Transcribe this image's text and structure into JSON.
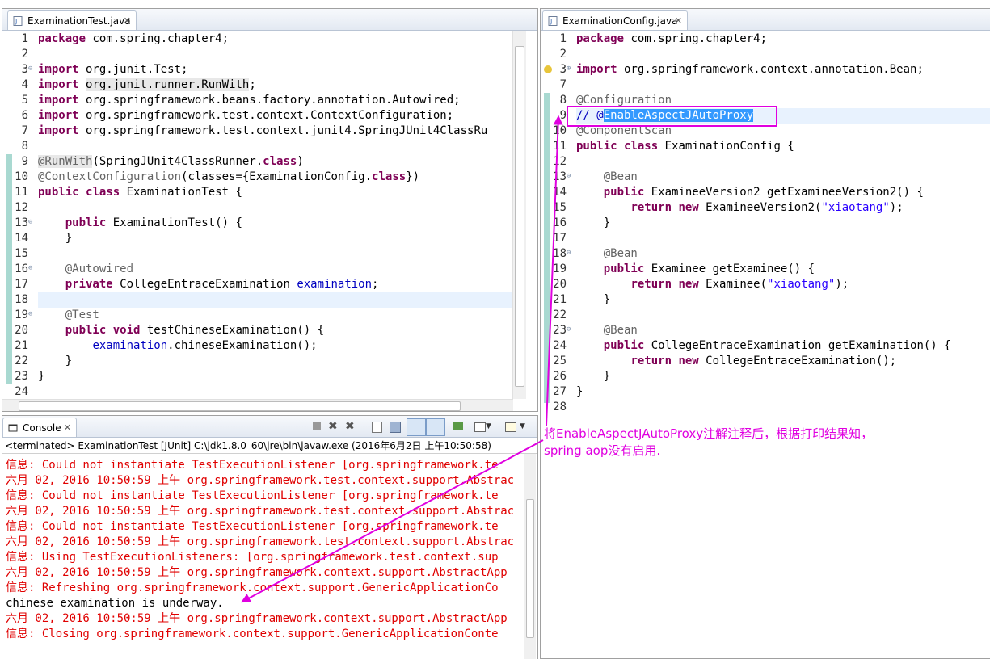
{
  "left_editor": {
    "tab_title": "ExaminationTest.java",
    "lines": [
      {
        "n": "1",
        "t": "package com.spring.chapter4;"
      },
      {
        "n": "2",
        "t": ""
      },
      {
        "n": "3",
        "t": "import org.junit.Test;"
      },
      {
        "n": "4",
        "t": "import org.junit.runner.RunWith;"
      },
      {
        "n": "5",
        "t": "import org.springframework.beans.factory.annotation.Autowired;"
      },
      {
        "n": "6",
        "t": "import org.springframework.test.context.ContextConfiguration;"
      },
      {
        "n": "7",
        "t": "import org.springframework.test.context.junit4.SpringJUnit4ClassRu"
      },
      {
        "n": "8",
        "t": ""
      },
      {
        "n": "9",
        "t": "@RunWith(SpringJUnit4ClassRunner.class)"
      },
      {
        "n": "10",
        "t": "@ContextConfiguration(classes={ExaminationConfig.class})"
      },
      {
        "n": "11",
        "t": "public class ExaminationTest {"
      },
      {
        "n": "12",
        "t": ""
      },
      {
        "n": "13",
        "t": "    public ExaminationTest() {"
      },
      {
        "n": "14",
        "t": "    }"
      },
      {
        "n": "15",
        "t": ""
      },
      {
        "n": "16",
        "t": "    @Autowired"
      },
      {
        "n": "17",
        "t": "    private CollegeEntraceExamination examination;"
      },
      {
        "n": "18",
        "t": ""
      },
      {
        "n": "19",
        "t": "    @Test"
      },
      {
        "n": "20",
        "t": "    public void testChineseExamination() {"
      },
      {
        "n": "21",
        "t": "        examination.chineseExamination();"
      },
      {
        "n": "22",
        "t": "    }"
      },
      {
        "n": "23",
        "t": "}"
      },
      {
        "n": "24",
        "t": ""
      }
    ]
  },
  "right_editor": {
    "tab_title": "ExaminationConfig.java",
    "lines": [
      {
        "n": "1",
        "t": "package com.spring.chapter4;"
      },
      {
        "n": "2",
        "t": ""
      },
      {
        "n": "3",
        "t": "import org.springframework.context.annotation.Bean;"
      },
      {
        "n": "7",
        "t": ""
      },
      {
        "n": "8",
        "t": "@Configuration"
      },
      {
        "n": "9",
        "t": "// @EnableAspectJAutoProxy"
      },
      {
        "n": "10",
        "t": "@ComponentScan"
      },
      {
        "n": "11",
        "t": "public class ExaminationConfig {"
      },
      {
        "n": "12",
        "t": ""
      },
      {
        "n": "13",
        "t": "    @Bean"
      },
      {
        "n": "14",
        "t": "    public ExamineeVersion2 getExamineeVersion2() {"
      },
      {
        "n": "15",
        "t": "        return new ExamineeVersion2(\"xiaotang\");"
      },
      {
        "n": "16",
        "t": "    }"
      },
      {
        "n": "17",
        "t": ""
      },
      {
        "n": "18",
        "t": "    @Bean"
      },
      {
        "n": "19",
        "t": "    public Examinee getExaminee() {"
      },
      {
        "n": "20",
        "t": "        return new Examinee(\"xiaotang\");"
      },
      {
        "n": "21",
        "t": "    }"
      },
      {
        "n": "22",
        "t": ""
      },
      {
        "n": "23",
        "t": "    @Bean"
      },
      {
        "n": "24",
        "t": "    public CollegeEntraceExamination getExamination() {"
      },
      {
        "n": "25",
        "t": "        return new CollegeEntraceExamination();"
      },
      {
        "n": "26",
        "t": "    }"
      },
      {
        "n": "27",
        "t": "}"
      },
      {
        "n": "28",
        "t": ""
      }
    ]
  },
  "console": {
    "tab_title": "Console",
    "status": "<terminated> ExaminationTest [JUnit] C:\\jdk1.8.0_60\\jre\\bin\\javaw.exe (2016年6月2日 上午10:50:58)",
    "lines": [
      {
        "t": "信息: Could not instantiate TestExecutionListener [org.springframework.te",
        "c": "red"
      },
      {
        "t": "六月 02, 2016 10:50:59 上午 org.springframework.test.context.support.Abstrac",
        "c": "red"
      },
      {
        "t": "信息: Could not instantiate TestExecutionListener [org.springframework.te",
        "c": "red"
      },
      {
        "t": "六月 02, 2016 10:50:59 上午 org.springframework.test.context.support.Abstrac",
        "c": "red"
      },
      {
        "t": "信息: Could not instantiate TestExecutionListener [org.springframework.te",
        "c": "red"
      },
      {
        "t": "六月 02, 2016 10:50:59 上午 org.springframework.test.context.support.Abstrac",
        "c": "red"
      },
      {
        "t": "信息: Using TestExecutionListeners: [org.springframework.test.context.sup",
        "c": "red"
      },
      {
        "t": "六月 02, 2016 10:50:59 上午 org.springframework.context.support.AbstractApp",
        "c": "red"
      },
      {
        "t": "信息: Refreshing org.springframework.context.support.GenericApplicationCo",
        "c": "red"
      },
      {
        "t": "chinese examination is underway.",
        "c": "black"
      },
      {
        "t": "六月 02, 2016 10:50:59 上午 org.springframework.context.support.AbstractApp",
        "c": "red"
      },
      {
        "t": "信息: Closing org.springframework.context.support.GenericApplicationConte",
        "c": "red"
      }
    ]
  },
  "annotation": {
    "line1": "将EnableAspectJAutoProxy注解注释后，根据打印结果知，",
    "line2": "spring aop没有启用.",
    "color": "#e000e0"
  }
}
